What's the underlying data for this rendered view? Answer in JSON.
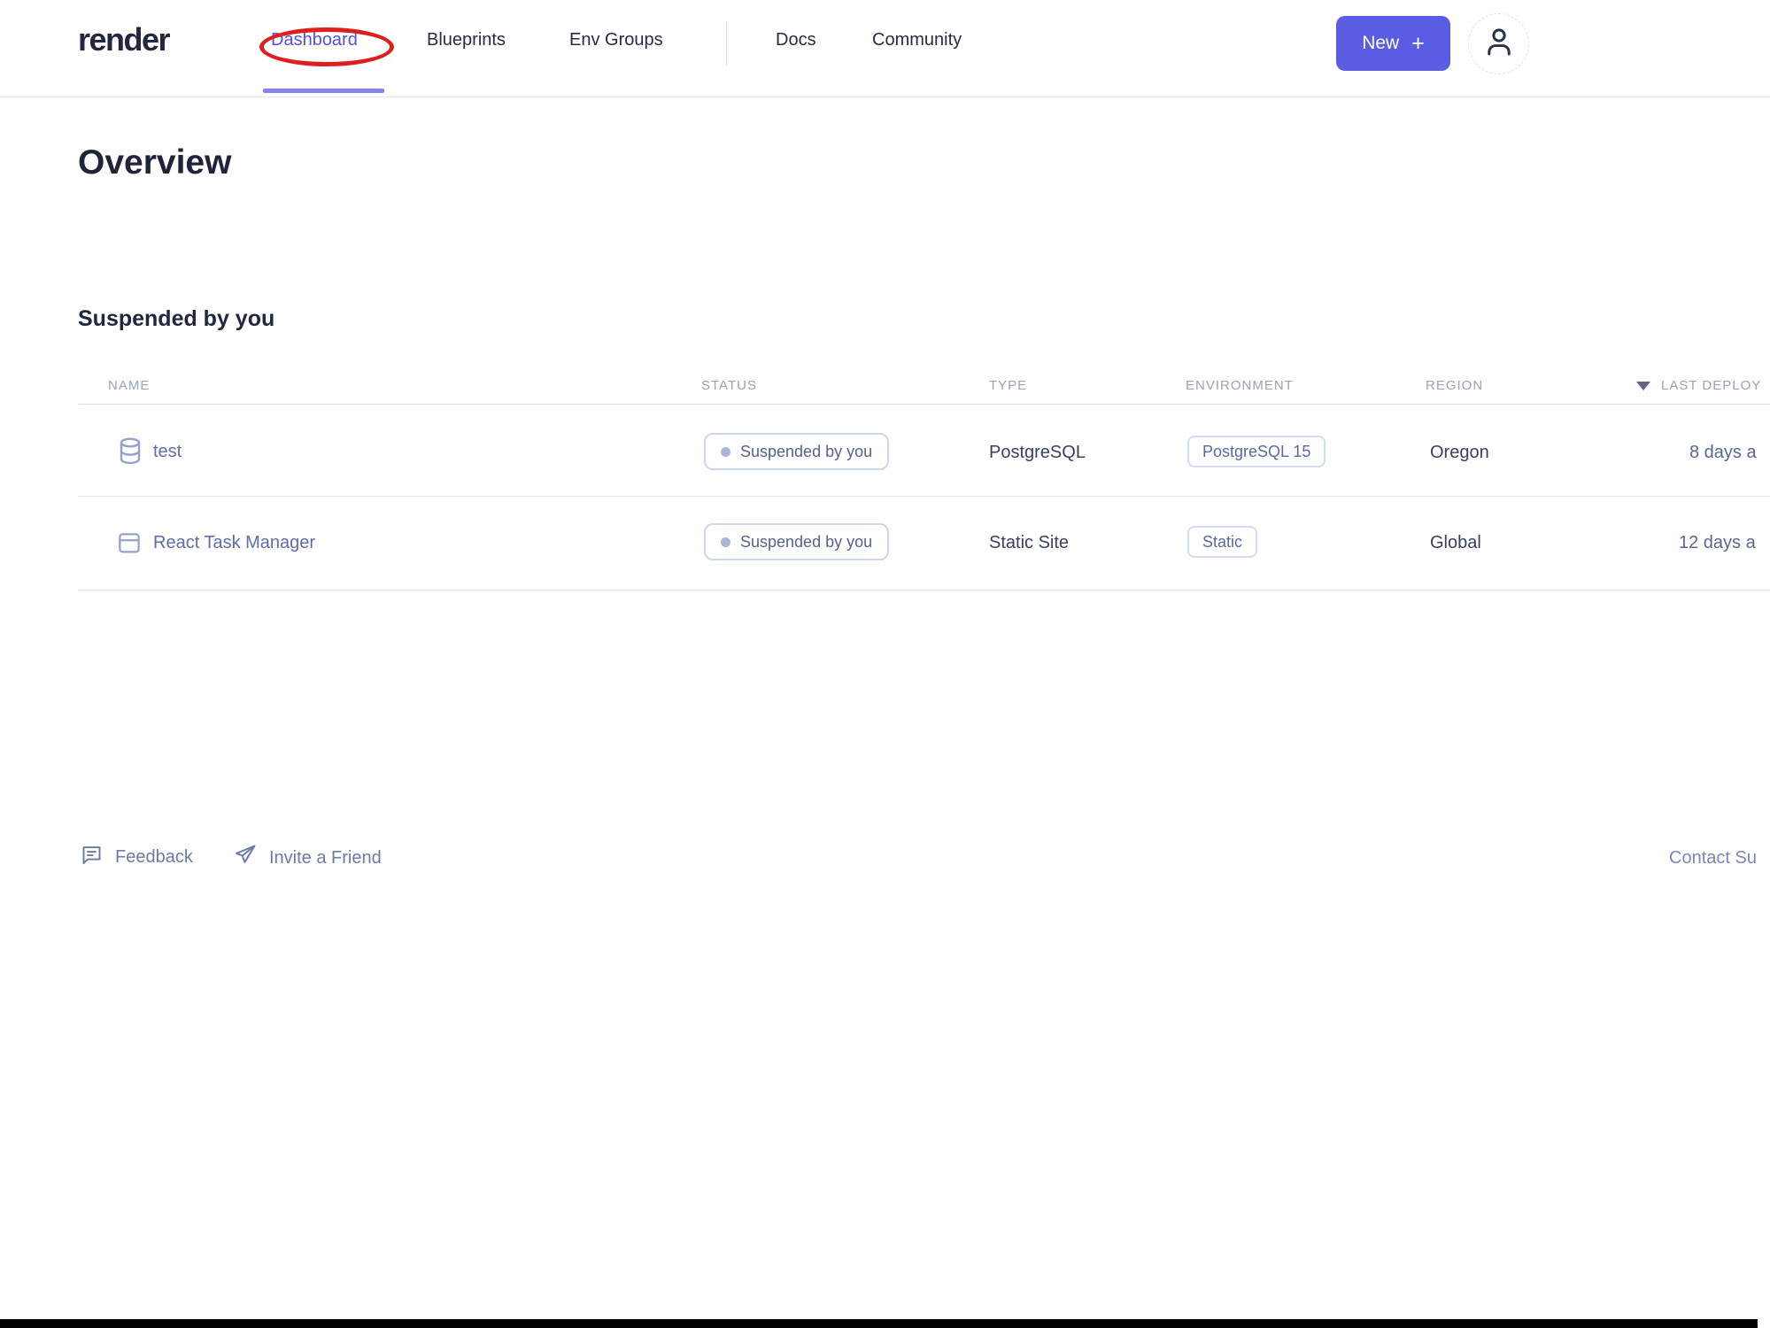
{
  "nav": {
    "logo": "render",
    "items": [
      {
        "label": "Dashboard",
        "active": true,
        "annotated": "red-ellipse"
      },
      {
        "label": "Blueprints",
        "active": false
      },
      {
        "label": "Env Groups",
        "active": false
      },
      {
        "label": "Docs",
        "active": false
      },
      {
        "label": "Community",
        "active": false
      }
    ],
    "new_button": {
      "label": "New",
      "plus": "+"
    }
  },
  "page": {
    "title": "Overview"
  },
  "section": {
    "title": "Suspended by you"
  },
  "table": {
    "columns": [
      "NAME",
      "STATUS",
      "TYPE",
      "ENVIRONMENT",
      "REGION",
      "LAST DEPLOY"
    ],
    "sort": {
      "column": "LAST DEPLOY",
      "direction": "descending"
    },
    "rows": [
      {
        "icon": "database-icon",
        "name": "test",
        "status": "Suspended by you",
        "type": "PostgreSQL",
        "environment": "PostgreSQL 15",
        "region": "Oregon",
        "last_deploy": "8 days a"
      },
      {
        "icon": "browser-icon",
        "name": "React Task Manager",
        "status": "Suspended by you",
        "type": "Static Site",
        "environment": "Static",
        "region": "Global",
        "last_deploy": "12 days a"
      }
    ]
  },
  "footer": {
    "feedback": "Feedback",
    "invite": "Invite a Friend",
    "contact": "Contact Su"
  },
  "colors": {
    "accent_button": "#5a5ce2",
    "active_nav": "#5450e0",
    "annotation_red": "#dd201d",
    "badge_border": "#ccd7ee",
    "link_slate": "#5f6dab"
  }
}
